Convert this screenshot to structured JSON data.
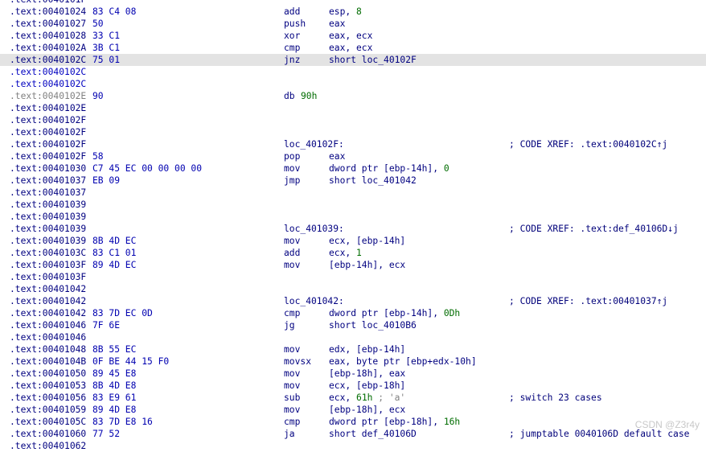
{
  "rows": [
    {
      "addr": ".text:0040101F"
    },
    {
      "addr": ".text:00401024",
      "bytes": "83 C4 08",
      "mn": "add",
      "ops": "esp, ",
      "num": "8"
    },
    {
      "addr": ".text:00401027",
      "bytes": "50",
      "mn": "push",
      "ops": "eax"
    },
    {
      "addr": ".text:00401028",
      "bytes": "33 C1",
      "mn": "xor",
      "ops": "eax, ecx"
    },
    {
      "addr": ".text:0040102A",
      "bytes": "3B C1",
      "mn": "cmp",
      "ops": "eax, ecx"
    },
    {
      "addr": ".text:0040102C",
      "bytes": "75 01",
      "mn": "jnz",
      "ops": "short loc_40102F",
      "hl": true
    },
    {
      "addr": ".text:0040102C",
      "sel": true
    },
    {
      "addr": ".text:0040102C",
      "sel": true,
      "sep": true
    },
    {
      "addr": ".text:0040102E",
      "bytes": "90",
      "mn": "db",
      "num": "90h",
      "grey": true
    },
    {
      "addr": ".text:0040102E",
      "sep": true
    },
    {
      "addr": ".text:0040102F"
    },
    {
      "addr": ".text:0040102F"
    },
    {
      "addr": ".text:0040102F",
      "label": "loc_40102F:",
      "cmt": "; CODE XREF: .text:0040102C↑j"
    },
    {
      "addr": ".text:0040102F",
      "bytes": "58",
      "mn": "pop",
      "ops": "eax"
    },
    {
      "addr": ".text:00401030",
      "bytes": "C7 45 EC 00 00 00 00",
      "mn": "mov",
      "ops": "dword ptr [ebp-14h], ",
      "num": "0"
    },
    {
      "addr": ".text:00401037",
      "bytes": "EB 09",
      "mn": "jmp",
      "ops": "short loc_401042"
    },
    {
      "addr": ".text:00401037"
    },
    {
      "addr": ".text:00401039",
      "sep": true
    },
    {
      "addr": ".text:00401039"
    },
    {
      "addr": ".text:00401039",
      "label": "loc_401039:",
      "cmt": "; CODE XREF: .text:def_40106D↓j"
    },
    {
      "addr": ".text:00401039",
      "bytes": "8B 4D EC",
      "mn": "mov",
      "ops": "ecx, [ebp-14h]"
    },
    {
      "addr": ".text:0040103C",
      "bytes": "83 C1 01",
      "mn": "add",
      "ops": "ecx, ",
      "num": "1"
    },
    {
      "addr": ".text:0040103F",
      "bytes": "89 4D EC",
      "mn": "mov",
      "ops": "[ebp-14h], ecx"
    },
    {
      "addr": ".text:0040103F"
    },
    {
      "addr": ".text:00401042"
    },
    {
      "addr": ".text:00401042",
      "label": "loc_401042:",
      "cmt": "; CODE XREF: .text:00401037↑j"
    },
    {
      "addr": ".text:00401042",
      "bytes": "83 7D EC 0D",
      "mn": "cmp",
      "ops": "dword ptr [ebp-14h], ",
      "num": "0Dh"
    },
    {
      "addr": ".text:00401046",
      "bytes": "7F 6E",
      "mn": "jg",
      "ops": "short loc_4010B6"
    },
    {
      "addr": ".text:00401046"
    },
    {
      "addr": ".text:00401048",
      "bytes": "8B 55 EC",
      "mn": "mov",
      "ops": "edx, [ebp-14h]"
    },
    {
      "addr": ".text:0040104B",
      "bytes": "0F BE 44 15 F0",
      "mn": "movsx",
      "ops": "eax, byte ptr [ebp+edx-10h]"
    },
    {
      "addr": ".text:00401050",
      "bytes": "89 45 E8",
      "mn": "mov",
      "ops": "[ebp-18h], eax"
    },
    {
      "addr": ".text:00401053",
      "bytes": "8B 4D E8",
      "mn": "mov",
      "ops": "ecx, [ebp-18h]"
    },
    {
      "addr": ".text:00401056",
      "bytes": "83 E9 61",
      "mn": "sub",
      "ops": "ecx, ",
      "num": "61h",
      "inline": " ; 'a'",
      "cmt": "; switch 23 cases"
    },
    {
      "addr": ".text:00401059",
      "bytes": "89 4D E8",
      "mn": "mov",
      "ops": "[ebp-18h], ecx"
    },
    {
      "addr": ".text:0040105C",
      "bytes": "83 7D E8 16",
      "mn": "cmp",
      "ops": "dword ptr [ebp-18h], ",
      "num": "16h"
    },
    {
      "addr": ".text:00401060",
      "bytes": "77 52",
      "mn": "ja",
      "ops": "short def_40106D",
      "cmt": "; jumptable 0040106D default case"
    },
    {
      "addr": ".text:00401062"
    }
  ],
  "watermark": "CSDN @Z3r4y"
}
